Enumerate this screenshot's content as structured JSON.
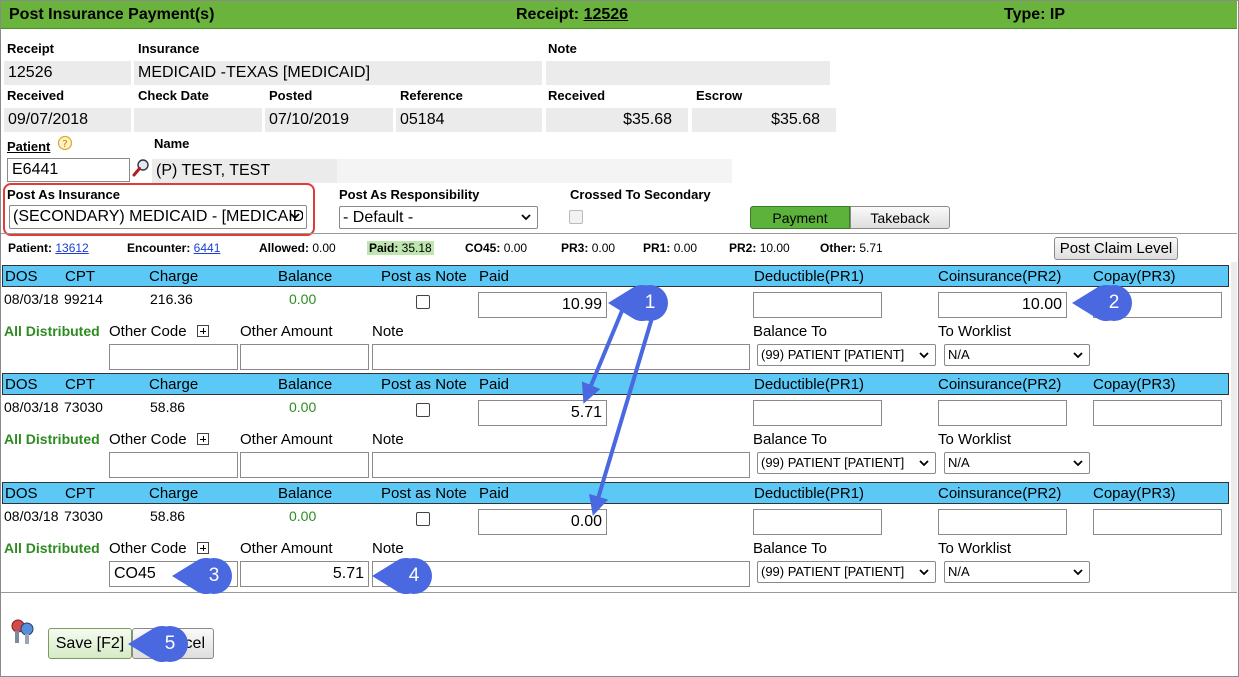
{
  "title": {
    "text": "Post Insurance Payment(s)",
    "receipt_label": "Receipt: ",
    "receipt_number": "12526",
    "type": "Type: IP"
  },
  "receipt": {
    "labels": {
      "receipt": "Receipt",
      "insurance": "Insurance",
      "note": "Note",
      "received": "Received",
      "check_date": "Check Date",
      "posted": "Posted",
      "reference": "Reference",
      "received_amount": "Received",
      "escrow": "Escrow"
    },
    "values": {
      "receipt": "12526",
      "insurance": "MEDICAID -TEXAS [MEDICAID]",
      "note": "",
      "received": "09/07/2018",
      "check_date": "",
      "posted": "07/10/2019",
      "reference": "05184",
      "received_amount": "$35.68",
      "escrow": "$35.68"
    }
  },
  "patient": {
    "label": "Patient",
    "name_label": "Name",
    "id": "E6441",
    "name": "(P)  TEST, TEST"
  },
  "posting": {
    "post_as_insurance_label": "Post As Insurance",
    "post_as_insurance_value": "(SECONDARY) MEDICAID - [MEDICAID]",
    "post_as_responsibility_label": "Post As Responsibility",
    "post_as_responsibility_value": "- Default -",
    "crossed_to_secondary_label": "Crossed To Secondary",
    "payment_button": "Payment",
    "takeback_button": "Takeback"
  },
  "summary": {
    "patient_label": "Patient: ",
    "patient_value": "13612",
    "encounter_label": "Encounter: ",
    "encounter_value": "6441",
    "allowed_label": "Allowed: ",
    "allowed_value": "0.00",
    "paid_label": "Paid: ",
    "paid_value": "35.18",
    "co45_label": "CO45: ",
    "co45_value": "0.00",
    "pr3_label": "PR3: ",
    "pr3_value": "0.00",
    "pr1_label": "PR1: ",
    "pr1_value": "0.00",
    "pr2_label": "PR2: ",
    "pr2_value": "10.00",
    "other_label": "Other: ",
    "other_value": "5.71",
    "post_claim_button": "Post Claim Level"
  },
  "columns": {
    "dos": "DOS",
    "cpt": "CPT",
    "charge": "Charge",
    "balance": "Balance",
    "post_as_note": "Post as Note",
    "paid": "Paid",
    "deductible": "Deductible(PR1)",
    "coinsurance": "Coinsurance(PR2)",
    "copay": "Copay(PR3)"
  },
  "sub_labels": {
    "all_distributed": "All Distributed",
    "other_code": "Other Code",
    "other_amount": "Other Amount",
    "note": "Note",
    "balance_to": "Balance To",
    "to_worklist": "To Worklist"
  },
  "lines": [
    {
      "dos": "08/03/18",
      "cpt": "99214",
      "charge": "216.36",
      "balance": "0.00",
      "paid": "10.99",
      "deductible": "",
      "coinsurance": "10.00",
      "copay": "",
      "other_code": "",
      "other_amount": "",
      "note": "",
      "balance_to": "(99) PATIENT [PATIENT]",
      "worklist": "N/A"
    },
    {
      "dos": "08/03/18",
      "cpt": "73030",
      "charge": "58.86",
      "balance": "0.00",
      "paid": "5.71",
      "deductible": "",
      "coinsurance": "",
      "copay": "",
      "other_code": "",
      "other_amount": "",
      "note": "",
      "balance_to": "(99) PATIENT [PATIENT]",
      "worklist": "N/A"
    },
    {
      "dos": "08/03/18",
      "cpt": "73030",
      "charge": "58.86",
      "balance": "0.00",
      "paid": "0.00",
      "deductible": "",
      "coinsurance": "",
      "copay": "",
      "other_code": "CO45",
      "other_amount": "5.71",
      "note": "",
      "balance_to": "(99) PATIENT [PATIENT]",
      "worklist": "N/A"
    }
  ],
  "footer": {
    "save_button": "Save [F2]",
    "cancel_button_visible": "cel"
  },
  "callouts": [
    "1",
    "2",
    "3",
    "4",
    "5"
  ],
  "colors": {
    "title_bar": "#6ab43e",
    "row_header": "#5bc8f5",
    "callout": "#4a68e0",
    "highlight_box": "#e03a3a",
    "distributed_text": "#2e8b22"
  },
  "icons": {
    "patient_help": "help-icon",
    "patient_lookup": "magnifier-icon",
    "other_code_add": "plus-box-icon",
    "app_logo": "keys-icon"
  }
}
